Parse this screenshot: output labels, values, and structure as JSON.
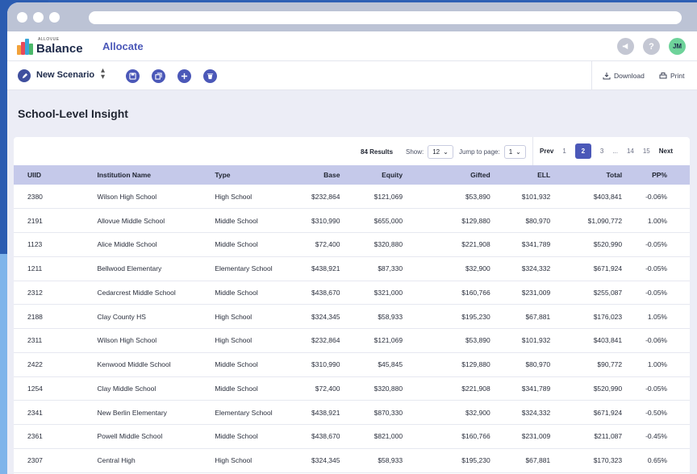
{
  "app": {
    "brand_small": "ALLOVUE",
    "brand": "Balance",
    "module": "Allocate",
    "avatar_initials": "JM",
    "accent": "#4b58b8"
  },
  "toolbar": {
    "scenario_label": "New Scenario",
    "download_label": "Download",
    "print_label": "Print"
  },
  "page": {
    "title": "School-Level Insight"
  },
  "controls": {
    "results": "84 Results",
    "show_label": "Show:",
    "show_value": "12",
    "jump_label": "Jump to page:",
    "jump_value": "1"
  },
  "pager": {
    "prev": "Prev",
    "pages": [
      "1",
      "2",
      "3",
      "...",
      "14",
      "15"
    ],
    "active": "2",
    "next": "Next"
  },
  "table": {
    "headers": [
      "UIID",
      "Institution Name",
      "Type",
      "Base",
      "Equity",
      "Gifted",
      "ELL",
      "Total",
      "PP%"
    ],
    "rows": [
      [
        "2380",
        "Wilson High School",
        "High School",
        "$232,864",
        "$121,069",
        "$53,890",
        "$101,932",
        "$403,841",
        "-0.06%"
      ],
      [
        "2191",
        "Allovue Middle School",
        "Middle School",
        "$310,990",
        "$655,000",
        "$129,880",
        "$80,970",
        "$1,090,772",
        "1.00%"
      ],
      [
        "1123",
        "Alice Middle School",
        "Middle School",
        "$72,400",
        "$320,880",
        "$221,908",
        "$341,789",
        "$520,990",
        "-0.05%"
      ],
      [
        "1211",
        "Bellwood Elementary",
        "Elementary School",
        "$438,921",
        "$87,330",
        "$32,900",
        "$324,332",
        "$671,924",
        "-0.05%"
      ],
      [
        "2312",
        "Cedarcrest Middle School",
        "Middle School",
        "$438,670",
        "$321,000",
        "$160,766",
        "$231,009",
        "$255,087",
        "-0.05%"
      ],
      [
        "2188",
        "Clay County HS",
        "High School",
        "$324,345",
        "$58,933",
        "$195,230",
        "$67,881",
        "$176,023",
        "1.05%"
      ],
      [
        "2311",
        "Wilson High School",
        "High School",
        "$232,864",
        "$121,069",
        "$53,890",
        "$101,932",
        "$403,841",
        "-0.06%"
      ],
      [
        "2422",
        "Kenwood Middle School",
        "Middle School",
        "$310,990",
        "$45,845",
        "$129,880",
        "$80,970",
        "$90,772",
        "1.00%"
      ],
      [
        "1254",
        "Clay Middle School",
        "Middle School",
        "$72,400",
        "$320,880",
        "$221,908",
        "$341,789",
        "$520,990",
        "-0.05%"
      ],
      [
        "2341",
        "New Berlin Elementary",
        "Elementary School",
        "$438,921",
        "$870,330",
        "$32,900",
        "$324,332",
        "$671,924",
        "-0.50%"
      ],
      [
        "2361",
        "Powell Middle School",
        "Middle School",
        "$438,670",
        "$821,000",
        "$160,766",
        "$231,009",
        "$211,087",
        "-0.45%"
      ],
      [
        "2307",
        "Central High",
        "High School",
        "$324,345",
        "$58,933",
        "$195,230",
        "$67,881",
        "$170,323",
        "0.65%"
      ]
    ]
  }
}
